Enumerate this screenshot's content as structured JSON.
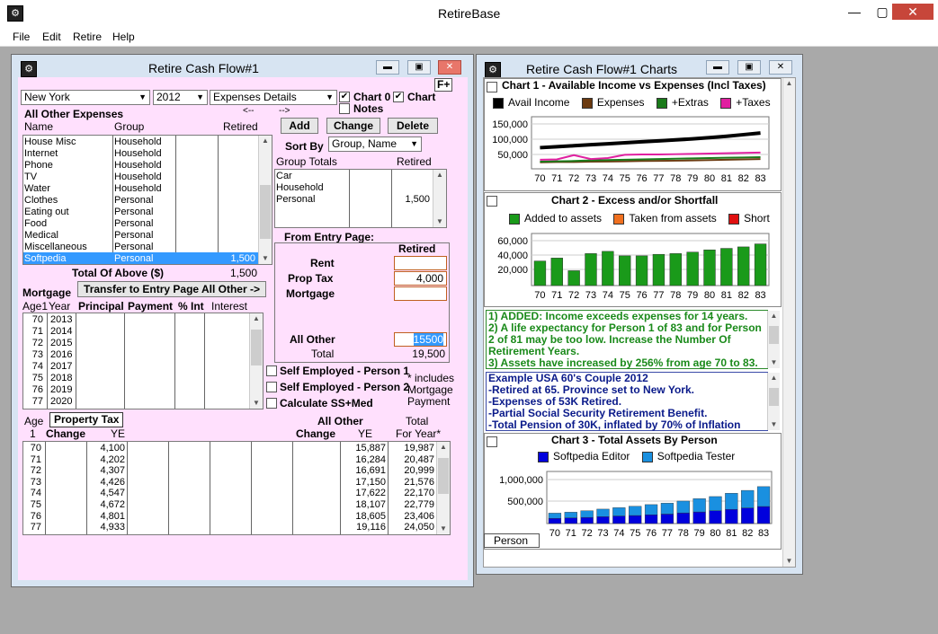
{
  "app": {
    "title": "RetireBase"
  },
  "menu": [
    "File",
    "Edit",
    "Retire",
    "Help"
  ],
  "system_buttons": [
    "—",
    "▢",
    "✕"
  ],
  "cashflow": {
    "title": "Retire Cash Flow#1",
    "state": "New York",
    "year": "2012",
    "view": "Expenses Details",
    "f_plus": "F+",
    "chart0": "Chart 0",
    "chart_label": "Chart",
    "notes": "Notes",
    "arrows_left": "<--",
    "arrows_right": "-->",
    "all_other_expenses": "All Other Expenses",
    "col_name": "Name",
    "col_group": "Group",
    "col_retired": "Retired",
    "add": "Add",
    "change": "Change",
    "delete": "Delete",
    "sort_by": "Sort By",
    "sort_value": "Group, Name",
    "group_totals": "Group Totals",
    "group_retired": "Retired",
    "groups": [
      "Car",
      "Household",
      "Personal"
    ],
    "group_values": [
      "",
      "",
      "1,500"
    ],
    "expenses": [
      {
        "name": "House Misc",
        "group": "Household",
        "retired": ""
      },
      {
        "name": "Internet",
        "group": "Household",
        "retired": ""
      },
      {
        "name": "Phone",
        "group": "Household",
        "retired": ""
      },
      {
        "name": "TV",
        "group": "Household",
        "retired": ""
      },
      {
        "name": "Water",
        "group": "Household",
        "retired": ""
      },
      {
        "name": "Clothes",
        "group": "Personal",
        "retired": ""
      },
      {
        "name": "Eating out",
        "group": "Personal",
        "retired": ""
      },
      {
        "name": "Food",
        "group": "Personal",
        "retired": ""
      },
      {
        "name": "Medical",
        "group": "Personal",
        "retired": ""
      },
      {
        "name": "Miscellaneous",
        "group": "Personal",
        "retired": ""
      },
      {
        "name": "Softpedia",
        "group": "Personal",
        "retired": "1,500"
      }
    ],
    "total_label": "Total Of Above ($)",
    "total_value": "1,500",
    "mortgage": "Mortgage",
    "transfer": "Transfer to Entry Page All Other ->",
    "from_entry": "From Entry Page:",
    "retired_hdr": "Retired",
    "rent": "Rent",
    "prop_tax": "Prop Tax",
    "mortgage_lbl": "Mortgage",
    "rent_val": "",
    "prop_tax_val": "4,000",
    "mortgage_val": "",
    "all_other": "All Other",
    "all_other_val": "15500",
    "total": "Total",
    "total_val": "19,500",
    "mort_hdr": {
      "age": "Age1",
      "year": "Year",
      "principal": "Principal",
      "payment": "Payment",
      "pct": "% Int",
      "interest": "Interest"
    },
    "mort_rows": [
      [
        "70",
        "2013"
      ],
      [
        "71",
        "2014"
      ],
      [
        "72",
        "2015"
      ],
      [
        "73",
        "2016"
      ],
      [
        "74",
        "2017"
      ],
      [
        "75",
        "2018"
      ],
      [
        "76",
        "2019"
      ],
      [
        "77",
        "2020"
      ]
    ],
    "self_emp1": "Self Employed - Person 1",
    "self_emp2": "Self Employed - Person 2",
    "calc_ss": "Calculate SS+Med",
    "includes": "* includes",
    "mort_pay1": "Mortgage",
    "mort_pay2": "Payment",
    "bot_hdr": {
      "age": "Age",
      "one": "1",
      "prop_tax": "Property Tax",
      "change": "Change",
      "ye": "YE",
      "all_other": "All Other",
      "change2": "Change",
      "ye2": "YE",
      "total": "Total",
      "for_year": "For Year*"
    },
    "bot_rows": [
      [
        "70",
        "4,100",
        "15,887",
        "19,987"
      ],
      [
        "71",
        "4,202",
        "16,284",
        "20,487"
      ],
      [
        "72",
        "4,307",
        "16,691",
        "20,999"
      ],
      [
        "73",
        "4,426",
        "17,150",
        "21,576"
      ],
      [
        "74",
        "4,547",
        "17,622",
        "22,170"
      ],
      [
        "75",
        "4,672",
        "18,107",
        "22,779"
      ],
      [
        "76",
        "4,801",
        "18,605",
        "23,406"
      ],
      [
        "77",
        "4,933",
        "19,116",
        "24,050"
      ]
    ]
  },
  "charts": {
    "title": "Retire Cash Flow#1 Charts",
    "chart1_title": "Chart 1 - Available Income vs Expenses (Incl Taxes)",
    "chart2_title": "Chart 2 - Excess and/or Shortfall",
    "chart3_title": "Chart 3 - Total Assets By Person",
    "person_tab": "Person",
    "messages": [
      "1) ADDED: Income exceeds expenses for 14 years.",
      "2) A life expectancy for Person 1 of 83 and for Person",
      "2 of 81 may be too low. Increase the Number Of",
      "Retirement Years.",
      "3) Assets have increased by 256% from age 70 to 83."
    ],
    "notes": [
      "Example USA 60's Couple 2012",
      "-Retired at 65. Province set to New York.",
      "-Expenses of 53K Retired.",
      "-Partial Social Security Retirement Benefit.",
      "-Total Pension of 30K, inflated by 70% of Inflation"
    ],
    "colors": {
      "avail": "#000000",
      "expenses": "#6b3a10",
      "extras": "#1a7a1a",
      "taxes": "#e020a0",
      "added": "#1a9a1a",
      "taken": "#f07020",
      "short": "#e01010",
      "editor": "#0000dd",
      "tester": "#1a90e0"
    }
  },
  "chart_data": [
    {
      "type": "line",
      "title": "Chart 1 - Available Income vs Expenses (Incl Taxes)",
      "x": [
        "70",
        "71",
        "72",
        "73",
        "74",
        "75",
        "76",
        "77",
        "78",
        "79",
        "80",
        "81",
        "82",
        "83"
      ],
      "yticks": [
        "150,000",
        "100,000",
        "50,000"
      ],
      "ylim": [
        0,
        160000
      ],
      "series": [
        {
          "name": "Avail Income",
          "values": [
            65000,
            68000,
            71000,
            74000,
            77000,
            80000,
            83000,
            86000,
            89000,
            92000,
            96000,
            100000,
            105000,
            110000
          ]
        },
        {
          "name": "Expenses",
          "values": [
            20000,
            21000,
            21000,
            22000,
            22500,
            23000,
            24000,
            24500,
            25000,
            26000,
            27000,
            28000,
            29000,
            30000
          ]
        },
        {
          "name": "+Extras",
          "values": [
            22000,
            23000,
            24000,
            26000,
            27000,
            28000,
            29000,
            30000,
            31000,
            32000,
            33000,
            34000,
            35000,
            36000
          ]
        },
        {
          "name": "+Taxes",
          "values": [
            28000,
            29000,
            42000,
            30000,
            33000,
            43000,
            44000,
            44000,
            45000,
            46000,
            47000,
            48000,
            49000,
            50000
          ]
        }
      ]
    },
    {
      "type": "bar",
      "title": "Chart 2 - Excess and/or Shortfall",
      "categories": [
        "70",
        "71",
        "72",
        "73",
        "74",
        "75",
        "76",
        "77",
        "78",
        "79",
        "80",
        "81",
        "82",
        "83"
      ],
      "yticks": [
        "60,000",
        "40,000",
        "20,000"
      ],
      "ylim": [
        0,
        70000
      ],
      "series": [
        {
          "name": "Added to assets",
          "values": [
            33000,
            37000,
            20000,
            43000,
            46000,
            40000,
            40000,
            42000,
            43000,
            45000,
            48000,
            50000,
            52000,
            56000
          ]
        },
        {
          "name": "Taken from assets",
          "values": [
            0,
            0,
            0,
            0,
            0,
            0,
            0,
            0,
            0,
            0,
            0,
            0,
            0,
            0
          ]
        },
        {
          "name": "Short",
          "values": [
            0,
            0,
            0,
            0,
            0,
            0,
            0,
            0,
            0,
            0,
            0,
            0,
            0,
            0
          ]
        }
      ]
    },
    {
      "type": "bar",
      "title": "Chart 3 - Total Assets By Person",
      "categories": [
        "70",
        "71",
        "72",
        "73",
        "74",
        "75",
        "76",
        "77",
        "78",
        "79",
        "80",
        "81",
        "82",
        "83"
      ],
      "yticks": [
        "1,000,000",
        "500,000"
      ],
      "ylim": [
        0,
        1100000
      ],
      "series": [
        {
          "name": "Softpedia Editor",
          "values": [
            110000,
            120000,
            130000,
            145000,
            160000,
            170000,
            185000,
            200000,
            225000,
            245000,
            270000,
            300000,
            330000,
            360000
          ]
        },
        {
          "name": "Softpedia Tester",
          "values": [
            110000,
            120000,
            140000,
            160000,
            175000,
            195000,
            215000,
            230000,
            250000,
            280000,
            300000,
            340000,
            370000,
            420000
          ]
        }
      ]
    }
  ]
}
